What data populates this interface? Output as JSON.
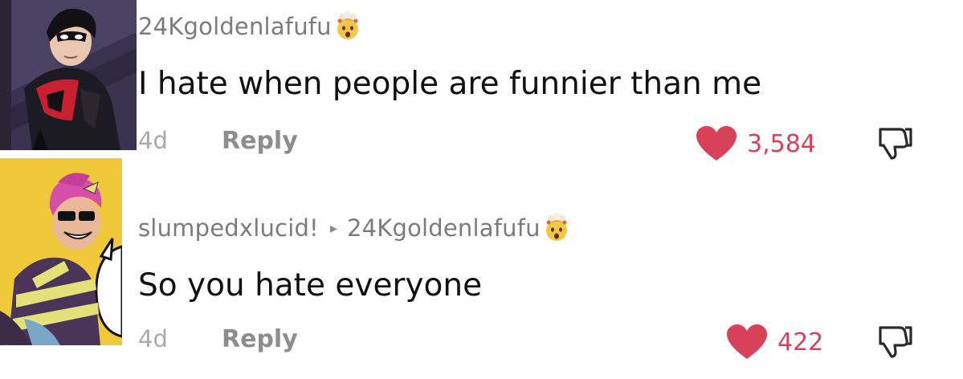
{
  "colors": {
    "username": "#7b7b7b",
    "text": "#111111",
    "meta": "#a9a9a9",
    "like_accent": "#d8415a"
  },
  "comments": [
    {
      "username": "24Kgoldenlafufu",
      "badge_icon": "exploding-head-emoji",
      "text": "I hate when people are funnier than me",
      "time": "4d",
      "reply_label": "Reply",
      "likes": "3,584",
      "like_icon": "heart-icon",
      "dislike_icon": "thumbs-down-icon"
    },
    {
      "username": "slumpedxlucid!",
      "reply_indicator": "▸",
      "replying_to": "24Kgoldenlafufu",
      "badge_icon": "exploding-head-emoji",
      "text": "So you hate everyone",
      "time": "4d",
      "reply_label": "Reply",
      "likes": "422",
      "like_icon": "heart-icon",
      "dislike_icon": "thumbs-down-icon"
    }
  ]
}
